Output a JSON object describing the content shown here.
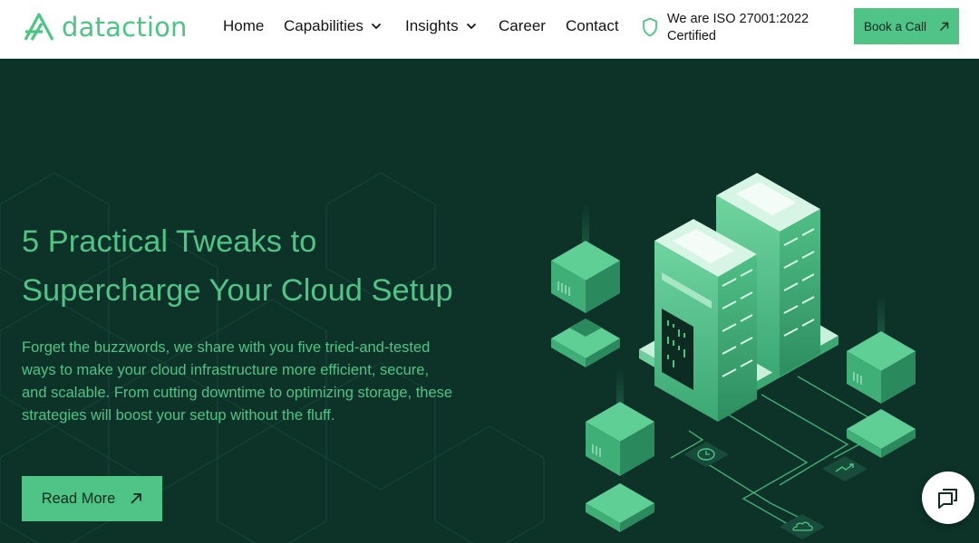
{
  "header": {
    "logo_text": "dataction",
    "nav": [
      {
        "label": "Home",
        "has_dropdown": false
      },
      {
        "label": "Capabilities",
        "has_dropdown": true
      },
      {
        "label": "Insights",
        "has_dropdown": true
      },
      {
        "label": "Career",
        "has_dropdown": false
      },
      {
        "label": "Contact",
        "has_dropdown": false
      }
    ],
    "iso_badge": {
      "icon": "shield-icon",
      "line1": "We are ISO 27001:2022",
      "line2": "Certified"
    },
    "cta_label": "Book a Call"
  },
  "hero": {
    "headline_line1": "5 Practical Tweaks to",
    "headline_line2": "Supercharge Your Cloud Setup",
    "body": "Forget the buzzwords, we share with you five tried-and-tested ways to make your cloud infrastructure more efficient, secure, and scalable. From cutting downtime to optimizing storage, these strategies will boost your setup without the fluff.",
    "button_label": "Read More"
  },
  "icons": {
    "clock": "clock-icon",
    "trend": "trend-up-icon",
    "cloud": "cloud-icon",
    "chat": "chat-icon"
  },
  "colors": {
    "brand_green": "#4fc486",
    "hero_bg": "#0d3228",
    "header_bg": "#ffffff",
    "text_dark": "#141414"
  }
}
